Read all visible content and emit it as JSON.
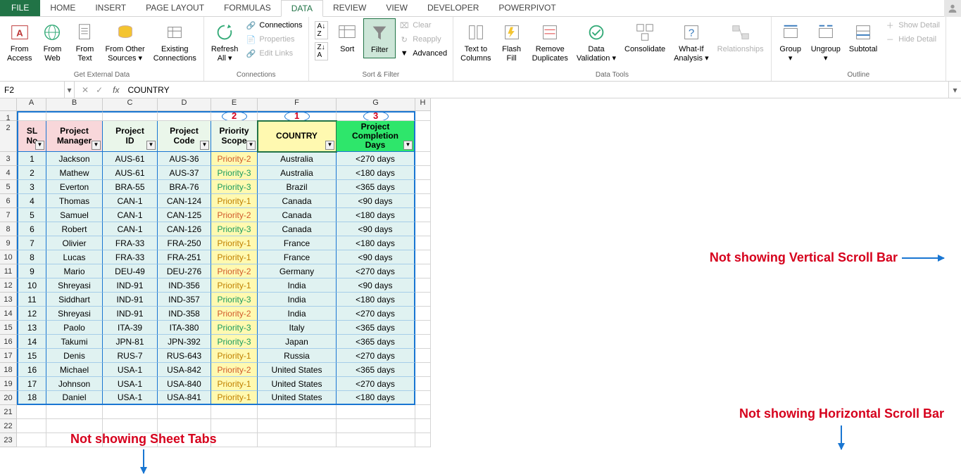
{
  "tabs": {
    "file": "FILE",
    "home": "HOME",
    "insert": "INSERT",
    "pagelayout": "PAGE LAYOUT",
    "formulas": "FORMULAS",
    "data": "DATA",
    "review": "REVIEW",
    "view": "VIEW",
    "developer": "DEVELOPER",
    "powerpivot": "POWERPIVOT"
  },
  "ribbon": {
    "group1": {
      "label": "Get External Data",
      "fromAccess": "From\nAccess",
      "fromWeb": "From\nWeb",
      "fromText": "From\nText",
      "fromOther": "From Other\nSources ▾",
      "existing": "Existing\nConnections"
    },
    "group2": {
      "label": "Connections",
      "refresh": "Refresh\nAll ▾",
      "connections": "Connections",
      "properties": "Properties",
      "editLinks": "Edit Links"
    },
    "group3": {
      "label": "Sort & Filter",
      "sort": "Sort",
      "filter": "Filter",
      "clear": "Clear",
      "reapply": "Reapply",
      "advanced": "Advanced"
    },
    "group4": {
      "label": "Data Tools",
      "textToCols": "Text to\nColumns",
      "flashFill": "Flash\nFill",
      "removeDup": "Remove\nDuplicates",
      "dataVal": "Data\nValidation ▾",
      "consolidate": "Consolidate",
      "whatif": "What-If\nAnalysis ▾",
      "relationships": "Relationships"
    },
    "group5": {
      "label": "Outline",
      "group": "Group\n▾",
      "ungroup": "Ungroup\n▾",
      "subtotal": "Subtotal",
      "showDetail": "Show Detail",
      "hideDetail": "Hide Detail"
    }
  },
  "formulaBar": {
    "nameBox": "F2",
    "formula": "COUNTRY"
  },
  "colHeaders": [
    "A",
    "B",
    "C",
    "D",
    "E",
    "F",
    "G",
    "H"
  ],
  "tableHeaders": {
    "sl": "SL\nNo",
    "pm": "Project\nManager",
    "pid": "Project\nID",
    "pcode": "Project\nCode",
    "pscope": "Priority\nScope",
    "country": "COUNTRY",
    "pcd": "Project\nCompletion\nDays"
  },
  "rows": [
    {
      "n": "1",
      "pm": "Jackson",
      "pid": "AUS-61",
      "pc": "AUS-36",
      "ps": "Priority-2",
      "co": "Australia",
      "days": "<270 days"
    },
    {
      "n": "2",
      "pm": "Mathew",
      "pid": "AUS-61",
      "pc": "AUS-37",
      "ps": "Priority-3",
      "co": "Australia",
      "days": "<180 days"
    },
    {
      "n": "3",
      "pm": "Everton",
      "pid": "BRA-55",
      "pc": "BRA-76",
      "ps": "Priority-3",
      "co": "Brazil",
      "days": "<365 days"
    },
    {
      "n": "4",
      "pm": "Thomas",
      "pid": "CAN-1",
      "pc": "CAN-124",
      "ps": "Priority-1",
      "co": "Canada",
      "days": "<90 days"
    },
    {
      "n": "5",
      "pm": "Samuel",
      "pid": "CAN-1",
      "pc": "CAN-125",
      "ps": "Priority-2",
      "co": "Canada",
      "days": "<180 days"
    },
    {
      "n": "6",
      "pm": "Robert",
      "pid": "CAN-1",
      "pc": "CAN-126",
      "ps": "Priority-3",
      "co": "Canada",
      "days": "<90 days"
    },
    {
      "n": "7",
      "pm": "Olivier",
      "pid": "FRA-33",
      "pc": "FRA-250",
      "ps": "Priority-1",
      "co": "France",
      "days": "<180 days"
    },
    {
      "n": "8",
      "pm": "Lucas",
      "pid": "FRA-33",
      "pc": "FRA-251",
      "ps": "Priority-1",
      "co": "France",
      "days": "<90 days"
    },
    {
      "n": "9",
      "pm": "Mario",
      "pid": "DEU-49",
      "pc": "DEU-276",
      "ps": "Priority-2",
      "co": "Germany",
      "days": "<270 days"
    },
    {
      "n": "10",
      "pm": "Shreyasi",
      "pid": "IND-91",
      "pc": "IND-356",
      "ps": "Priority-1",
      "co": "India",
      "days": "<90 days"
    },
    {
      "n": "11",
      "pm": "Siddhart",
      "pid": "IND-91",
      "pc": "IND-357",
      "ps": "Priority-3",
      "co": "India",
      "days": "<180 days"
    },
    {
      "n": "12",
      "pm": "Shreyasi",
      "pid": "IND-91",
      "pc": "IND-358",
      "ps": "Priority-2",
      "co": "India",
      "days": "<270 days"
    },
    {
      "n": "13",
      "pm": "Paolo",
      "pid": "ITA-39",
      "pc": "ITA-380",
      "ps": "Priority-3",
      "co": "Italy",
      "days": "<365 days"
    },
    {
      "n": "14",
      "pm": "Takumi",
      "pid": "JPN-81",
      "pc": "JPN-392",
      "ps": "Priority-3",
      "co": "Japan",
      "days": "<365 days"
    },
    {
      "n": "15",
      "pm": "Denis",
      "pid": "RUS-7",
      "pc": "RUS-643",
      "ps": "Priority-1",
      "co": "Russia",
      "days": "<270 days"
    },
    {
      "n": "16",
      "pm": "Michael",
      "pid": "USA-1",
      "pc": "USA-842",
      "ps": "Priority-2",
      "co": "United States",
      "days": "<365 days"
    },
    {
      "n": "17",
      "pm": "Johnson",
      "pid": "USA-1",
      "pc": "USA-840",
      "ps": "Priority-1",
      "co": "United States",
      "days": "<270 days"
    },
    {
      "n": "18",
      "pm": "Daniel",
      "pid": "USA-1",
      "pc": "USA-841",
      "ps": "Priority-1",
      "co": "United States",
      "days": "<180 days"
    }
  ],
  "annotations": {
    "vscroll": "Not showing Vertical Scroll Bar",
    "hscroll": "Not showing Horizontal Scroll Bar",
    "tabs": "Not showing Sheet Tabs",
    "badge1": "1",
    "badge2": "2",
    "badge3": "3"
  }
}
